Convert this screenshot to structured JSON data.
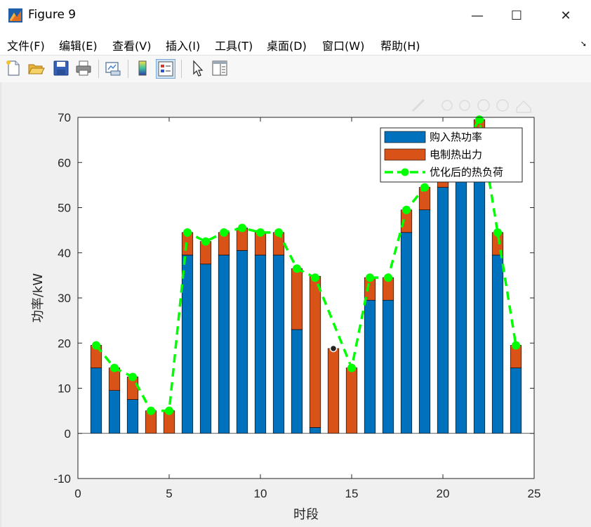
{
  "window": {
    "title": "Figure 9",
    "minimize_glyph": "—",
    "maximize_glyph": "☐",
    "close_glyph": "✕"
  },
  "menu": {
    "items": [
      "文件(F)",
      "编辑(E)",
      "查看(V)",
      "插入(I)",
      "工具(T)",
      "桌面(D)",
      "窗口(W)",
      "帮助(H)"
    ],
    "overflow_glyph": "➘"
  },
  "toolbar": {
    "buttons": [
      "new-file-icon",
      "open-folder-icon",
      "save-icon",
      "print-icon",
      "link-plot-icon",
      "colorbar-icon",
      "legend-icon",
      "pointer-icon",
      "property-inspector-icon"
    ]
  },
  "colors": {
    "series1": "#0072BD",
    "series2": "#D95319",
    "line": "#00FF00",
    "axes": "#262626"
  },
  "chart_data": {
    "type": "bar",
    "stacked": true,
    "x": [
      1,
      2,
      3,
      4,
      5,
      6,
      7,
      8,
      9,
      10,
      11,
      12,
      13,
      14,
      15,
      16,
      17,
      18,
      19,
      20,
      21,
      22,
      23,
      24
    ],
    "series": [
      {
        "name": "购入热功率",
        "type": "bar",
        "values": [
          14.5,
          9.5,
          7.5,
          0,
          0,
          39.5,
          37.5,
          39.5,
          40.5,
          39.5,
          39.5,
          23,
          1.3,
          0,
          0,
          29.5,
          29.5,
          44.5,
          49.5,
          54.5,
          58,
          64.5,
          39.5,
          14.5
        ]
      },
      {
        "name": "电制热出力",
        "type": "bar",
        "values": [
          5,
          5,
          5,
          5,
          5,
          5,
          5,
          5,
          5,
          5,
          5,
          13.5,
          33.5,
          18.8,
          14.5,
          5,
          5,
          5,
          5,
          5,
          5,
          5,
          5,
          5
        ]
      },
      {
        "name": "优化后的热负荷",
        "type": "line",
        "values": [
          19.5,
          14.5,
          12.5,
          5,
          5,
          44.5,
          42.5,
          44.5,
          45.5,
          44.5,
          44.5,
          36.5,
          34.5,
          null,
          14.5,
          34.5,
          34.5,
          49.5,
          54.5,
          59.5,
          63,
          69.5,
          44.5,
          19.5
        ]
      }
    ],
    "data_tip": {
      "x": 14,
      "y": 18.8
    },
    "xlabel": "时段",
    "ylabel": "功率/kW",
    "xlim": [
      0,
      25
    ],
    "ylim": [
      -10,
      70
    ],
    "xticks": [
      0,
      5,
      10,
      15,
      20,
      25
    ],
    "yticks": [
      -10,
      0,
      10,
      20,
      30,
      40,
      50,
      60,
      70
    ],
    "grid": false,
    "legend_position": "top-right"
  }
}
